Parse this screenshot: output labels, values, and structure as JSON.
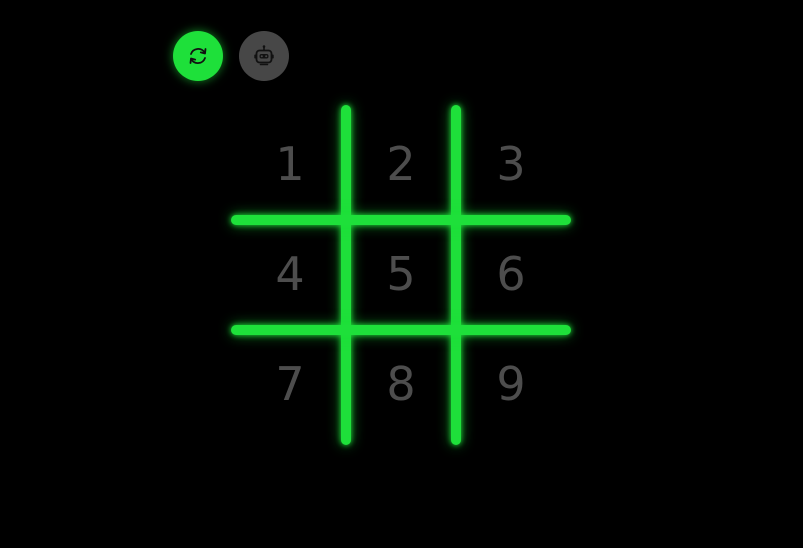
{
  "toolbar": {
    "restart_icon": "refresh-icon",
    "bot_icon": "robot-icon"
  },
  "board": {
    "cells": [
      "1",
      "2",
      "3",
      "4",
      "5",
      "6",
      "7",
      "8",
      "9"
    ]
  },
  "colors": {
    "background": "#000000",
    "accent_green": "#1ee03a",
    "bot_button": "#474747",
    "cell_number": "#4d4d4d"
  }
}
